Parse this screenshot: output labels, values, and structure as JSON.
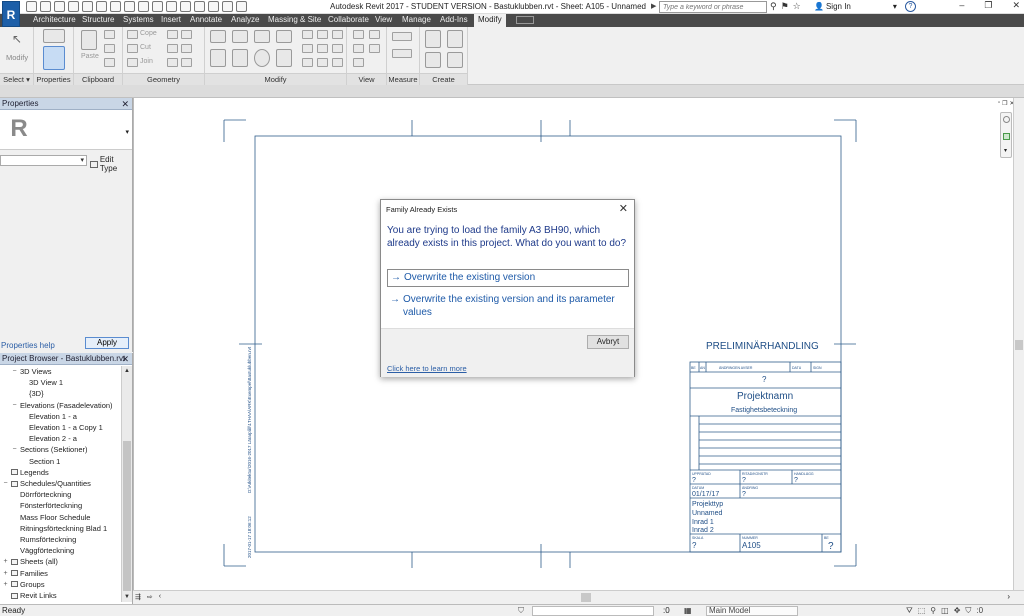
{
  "titlebar": {
    "title": "Autodesk Revit 2017 - STUDENT VERSION -    Bastuklubben.rvt - Sheet: A105 - Unnamed",
    "search_placeholder": "Type a keyword or phrase",
    "signin_label": "Sign In",
    "help_label": "?"
  },
  "ribbon": {
    "tabs": [
      "Architecture",
      "Structure",
      "Systems",
      "Insert",
      "Annotate",
      "Analyze",
      "Massing & Site",
      "Collaborate",
      "View",
      "Manage",
      "Add-Ins",
      "Modify"
    ],
    "active_tab": "Modify",
    "groups": {
      "select": "Select",
      "properties": "Properties",
      "clipboard": "Clipboard",
      "geometry": "Geometry",
      "modify": "Modify",
      "view": "View",
      "measure": "Measure",
      "create": "Create"
    },
    "modify_button": "Modify",
    "paste_button": "Paste",
    "cope_label": "Cope",
    "cut_label": "Cut",
    "join_label": "Join"
  },
  "properties": {
    "title": "Properties",
    "edit_type": "Edit Type",
    "help": "Properties help",
    "apply": "Apply",
    "type_icon": "R"
  },
  "project_browser": {
    "title": "Project Browser - Bastuklubben.rvt",
    "items": [
      {
        "label": "3D Views",
        "indent": 1,
        "toggle": "−"
      },
      {
        "label": "3D View 1",
        "indent": 2,
        "toggle": ""
      },
      {
        "label": "{3D}",
        "indent": 2,
        "toggle": ""
      },
      {
        "label": "Elevations (Fasadelevation)",
        "indent": 1,
        "toggle": "−"
      },
      {
        "label": "Elevation 1 - a",
        "indent": 2,
        "toggle": ""
      },
      {
        "label": "Elevation 1 - a Copy 1",
        "indent": 2,
        "toggle": ""
      },
      {
        "label": "Elevation 2 - a",
        "indent": 2,
        "toggle": ""
      },
      {
        "label": "Sections (Sektioner)",
        "indent": 1,
        "toggle": "−"
      },
      {
        "label": "Section 1",
        "indent": 2,
        "toggle": ""
      },
      {
        "label": "Legends",
        "indent": 0,
        "toggle": "",
        "icon": true
      },
      {
        "label": "Schedules/Quantities",
        "indent": 0,
        "toggle": "−",
        "icon": true
      },
      {
        "label": "Dörrförteckning",
        "indent": 1,
        "toggle": ""
      },
      {
        "label": "Fönsterförteckning",
        "indent": 1,
        "toggle": ""
      },
      {
        "label": "Mass Floor Schedule",
        "indent": 1,
        "toggle": ""
      },
      {
        "label": "Ritningsförteckning Blad 1",
        "indent": 1,
        "toggle": ""
      },
      {
        "label": "Rumsförteckning",
        "indent": 1,
        "toggle": ""
      },
      {
        "label": "Väggförteckning",
        "indent": 1,
        "toggle": ""
      },
      {
        "label": "Sheets (all)",
        "indent": 0,
        "toggle": "+",
        "icon": true
      },
      {
        "label": "Families",
        "indent": 0,
        "toggle": "+",
        "icon": true
      },
      {
        "label": "Groups",
        "indent": 0,
        "toggle": "+",
        "icon": true
      },
      {
        "label": "Revit Links",
        "indent": 0,
        "toggle": "",
        "icon": true
      }
    ]
  },
  "sheet": {
    "stamp": "PRELIMINÄRHANDLING",
    "rev_headers": [
      "BE",
      "AN",
      "ÄNDRINGEN AVSER",
      "DATU",
      "SIGN"
    ],
    "rev_value": "?",
    "project_name": "Projektnamn",
    "property_label": "Fastighetsbeteckning",
    "cells": {
      "upprattad_label": "UPPRÄTAD",
      "upprattad_value": "?",
      "ritad_label": "RITAD/KONSTR",
      "ritad_value": "?",
      "handlagg_label": "HANDLÄGG",
      "handlagg_value": "?",
      "datum_label": "DATUM",
      "datum_value": "01/17/17",
      "andring_label": "ÄNDRING",
      "andring_value": "?",
      "projekttyp": "Projekttyp",
      "unnamed": "Unnamed",
      "inrad1": "Inrad 1",
      "inrad2": "Inrad 2",
      "skala_label": "SKALA",
      "skala_value": "?",
      "nummer_label": "NUMMER",
      "nummer_value": "A105",
      "bet_label": "BE",
      "bet_value": "?"
    },
    "side_text": "D:\\Arkitektur\\2016-2017 Lärarpåll\\1THAA\\ARK\\Exempel\\Bastuklubben.rvt",
    "side_date": "2017-01-17 18:06:12"
  },
  "dialog": {
    "title": "Family Already Exists",
    "close": "✕",
    "message": "You are trying to load the family A3 BH90, which already exists in this project.  What do you want to do?",
    "option1": "Overwrite the existing version",
    "option2": "Overwrite the existing version and its parameter values",
    "cancel": "Avbryt",
    "learn_more": "Click here to learn more",
    "arrow": "→"
  },
  "status": {
    "text": "Ready",
    "zero": ":0",
    "model": "Main Model",
    "right_zero": ":0"
  }
}
